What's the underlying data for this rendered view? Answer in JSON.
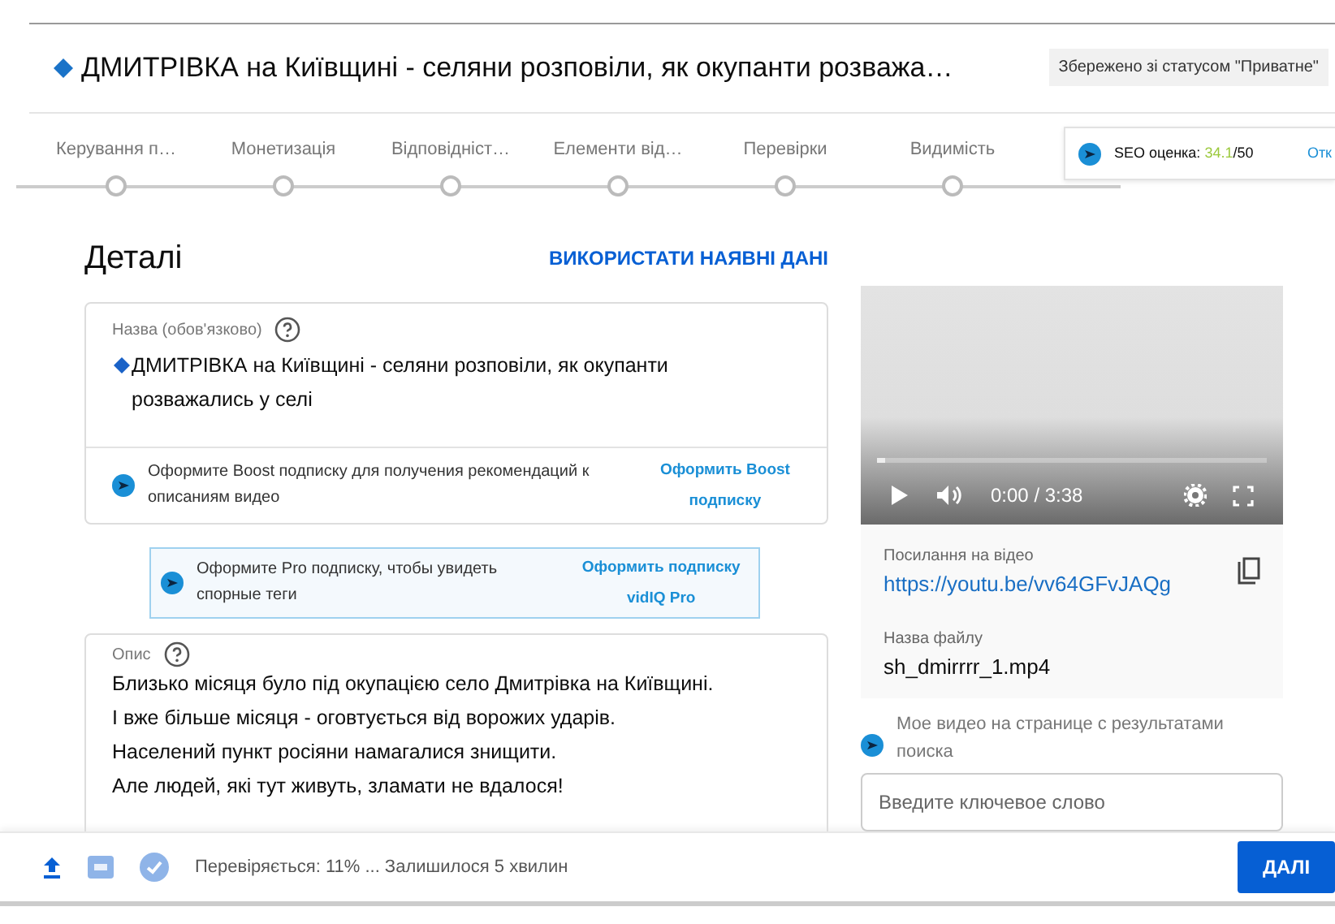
{
  "header": {
    "title": "ДМИТРІВКА на Київщині - селяни розповіли, як окупанти розважа…",
    "status": "Збережено зі статусом \"Приватне\""
  },
  "steps": [
    {
      "label": "Керування п…"
    },
    {
      "label": "Монетизація"
    },
    {
      "label": "Відповідніст…"
    },
    {
      "label": "Елементи від…"
    },
    {
      "label": "Перевірки"
    },
    {
      "label": "Видимість"
    }
  ],
  "seo": {
    "label": "SEO оценка:",
    "score": "34.1",
    "max": "/50",
    "link": "Отк"
  },
  "details": {
    "heading": "Деталі",
    "reuse_link": "ВИКОРИСТАТИ НАЯВНІ ДАНІ"
  },
  "title_field": {
    "label": "Назва (обов'язково)",
    "value": "ДМИТРІВКА на Київщині - селяни розповіли, як окупанти розважались у селі"
  },
  "boost_promo": {
    "text": "Оформите Boost подписку для получения рекомендаций к описаниям видео",
    "link": "Оформить Boost подписку"
  },
  "pro_promo": {
    "text": "Оформите Pro подписку, чтобы увидеть спорные теги",
    "link": "Оформить подписку vidIQ Pro"
  },
  "description_field": {
    "label": "Опис",
    "lines": [
      "Близько місяця було під окупацією село Дмитрівка на Київщині.",
      "І вже більше місяця - оговтується від ворожих ударів.",
      "Населений пункт росіяни намагалися знищити.",
      "Але людей, які тут живуть, зламати не вдалося!"
    ]
  },
  "video": {
    "time": "0:00 / 3:38",
    "level": 0.02
  },
  "video_info": {
    "link_label": "Посилання на відео",
    "link": "https://youtu.be/vv64GFvJAQg",
    "file_label": "Назва файлу",
    "file": "sh_dmirrrr_1.mp4"
  },
  "search_rank": {
    "text": "Мое видео на странице с результатами поиска",
    "placeholder": "Введите ключевое слово"
  },
  "footer": {
    "status": "Перевіряється: 11% ... Залишилося 5 хвилин",
    "next": "ДАЛІ"
  }
}
